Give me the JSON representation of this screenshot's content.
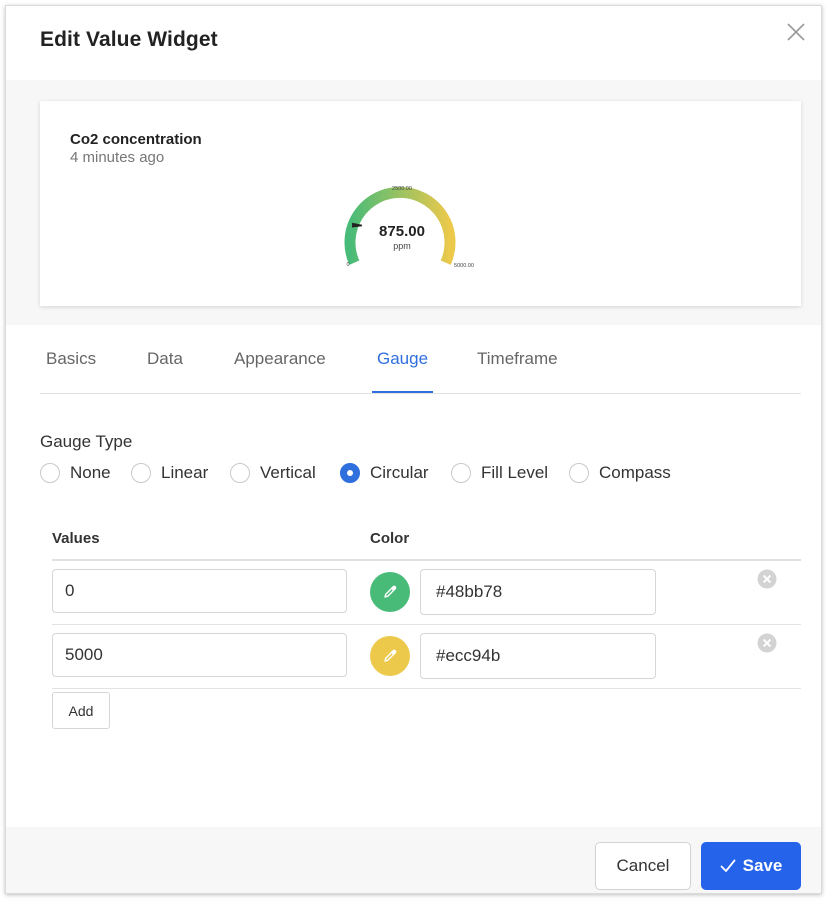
{
  "dialog": {
    "title": "Edit Value Widget",
    "close_icon": "close-icon"
  },
  "preview": {
    "widget_name": "Co2 concentration",
    "last_update": "4 minutes ago",
    "gauge": {
      "value_label": "875.00",
      "unit": "ppm",
      "min_label": "0",
      "mid_label": "2500.00",
      "max_label": "5000.00",
      "value": 875,
      "min": 0,
      "max": 5000,
      "start_color": "#48bb78",
      "end_color": "#ecc94b"
    }
  },
  "tabs": [
    {
      "label": "Basics",
      "active": false
    },
    {
      "label": "Data",
      "active": false
    },
    {
      "label": "Appearance",
      "active": false
    },
    {
      "label": "Gauge",
      "active": true
    },
    {
      "label": "Timeframe",
      "active": false
    }
  ],
  "gauge_type": {
    "label": "Gauge Type",
    "selected": "Circular",
    "options": [
      "None",
      "Linear",
      "Vertical",
      "Circular",
      "Fill Level",
      "Compass"
    ]
  },
  "stops_table": {
    "headers": {
      "values": "Values",
      "color": "Color"
    },
    "rows": [
      {
        "value": "0",
        "color": "#48bb78",
        "picker_icon": "eyedropper-icon",
        "remove_icon": "remove-circle-icon"
      },
      {
        "value": "5000",
        "color": "#ecc94b",
        "picker_icon": "eyedropper-icon",
        "remove_icon": "remove-circle-icon"
      }
    ],
    "add_label": "Add"
  },
  "footer": {
    "cancel_label": "Cancel",
    "save_label": "Save",
    "save_icon": "check-icon",
    "accent": "#2563eb"
  }
}
